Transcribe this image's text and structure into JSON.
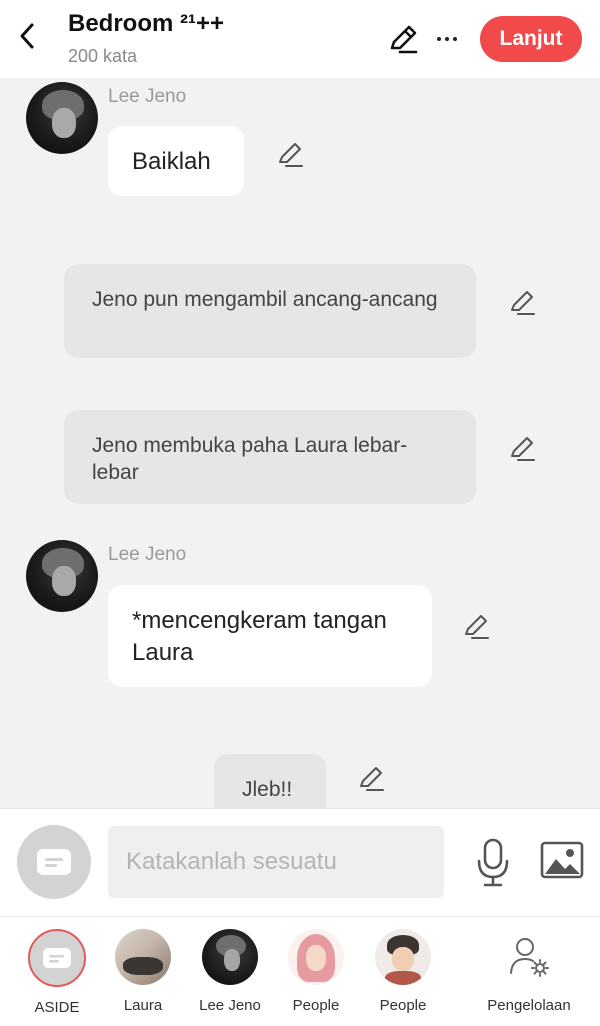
{
  "header": {
    "title": "Bedroom ²¹++",
    "subtitle": "200 kata",
    "next_label": "Lanjut"
  },
  "messages": [
    {
      "type": "character",
      "sender": "Lee Jeno",
      "text": "Baiklah"
    },
    {
      "type": "narration",
      "text": "Jeno pun mengambil ancang-ancang"
    },
    {
      "type": "narration",
      "text": "Jeno membuka paha Laura lebar-lebar"
    },
    {
      "type": "character",
      "sender": "Lee Jeno",
      "text": "*mencengkeram tangan Laura"
    },
    {
      "type": "narration",
      "text": "Jleb!!"
    }
  ],
  "input": {
    "placeholder": "Katakanlah sesuatu",
    "value": ""
  },
  "characters": [
    {
      "label": "ASIDE"
    },
    {
      "label": "Laura"
    },
    {
      "label": "Lee Jeno"
    },
    {
      "label": "People"
    },
    {
      "label": "People"
    },
    {
      "label": "Pengelolaan"
    }
  ],
  "colors": {
    "accent": "#f24a4a",
    "background": "#f2f2f2"
  },
  "icons": {
    "back": "chevron-left-icon",
    "edit": "pencil-icon",
    "more": "more-horizontal-icon",
    "aside": "aside-bubble-icon",
    "mic": "microphone-icon",
    "image": "image-icon",
    "manage": "user-gear-icon"
  }
}
